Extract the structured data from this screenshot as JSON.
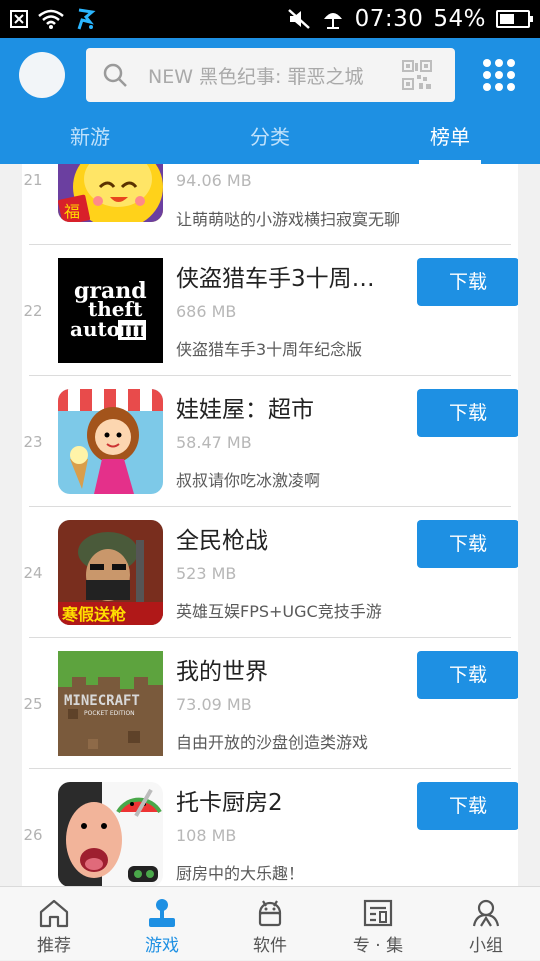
{
  "status_bar": {
    "time": "07:30",
    "battery_pct": "54%",
    "battery_level": 0.54
  },
  "header": {
    "search_placeholder": "NEW 黑色纪事: 罪恶之城",
    "tabs": [
      "新游",
      "分类",
      "榜单"
    ],
    "active_tab": "榜单"
  },
  "apps": [
    {
      "rank": "21",
      "name": "",
      "size": "94.06 MB",
      "desc": "让萌萌哒的小游戏横扫寂寞无聊",
      "button": ""
    },
    {
      "rank": "22",
      "name": "侠盗猎车手3十周…",
      "size": "686 MB",
      "desc": "侠盗猎车手3十周年纪念版",
      "button": "下载"
    },
    {
      "rank": "23",
      "name": "娃娃屋：超市",
      "size": "58.47 MB",
      "desc": "叔叔请你吃冰激凌啊",
      "button": "下载"
    },
    {
      "rank": "24",
      "name": "全民枪战",
      "size": "523 MB",
      "desc": "英雄互娱FPS+UGC竞技手游",
      "button": "下载"
    },
    {
      "rank": "25",
      "name": "我的世界",
      "size": "73.09 MB",
      "desc": "自由开放的沙盘创造类游戏",
      "button": "下载"
    },
    {
      "rank": "26",
      "name": "托卡厨房2",
      "size": "108 MB",
      "desc": "厨房中的大乐趣！",
      "button": "下载"
    }
  ],
  "icon_text": {
    "gta_line1": "grand",
    "gta_line2": "theft",
    "gta_line3": "auto",
    "gta_numeral": "III",
    "fu_char": "福",
    "cf_banner": "寒假送枪",
    "mc_logo": "MINECRAFT",
    "mc_edition": "POCKET EDITION"
  },
  "bottom_nav": [
    {
      "label": "推荐",
      "icon": "home-icon"
    },
    {
      "label": "游戏",
      "icon": "joystick-icon"
    },
    {
      "label": "软件",
      "icon": "android-icon"
    },
    {
      "label": "专 · 集",
      "icon": "collection-icon"
    },
    {
      "label": "小组",
      "icon": "group-icon"
    }
  ],
  "active_nav": "游戏",
  "colors": {
    "accent": "#1e90e3",
    "status_bar": "#000000"
  }
}
